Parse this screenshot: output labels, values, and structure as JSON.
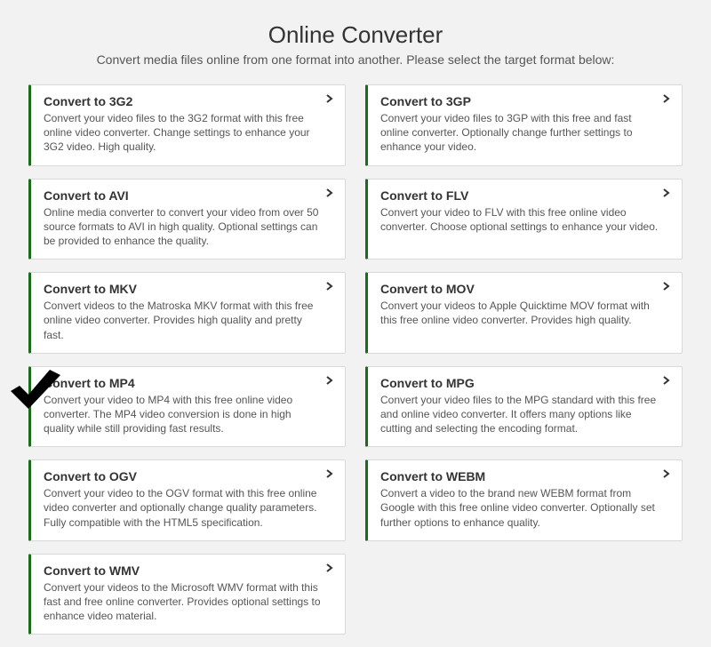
{
  "header": {
    "title": "Online Converter",
    "subtitle": "Convert media files online from one format into another. Please select the target format below:"
  },
  "colors": {
    "accent": "#1c6b1c",
    "card_bg": "#ffffff",
    "page_bg": "#f2f2f2",
    "border": "#d9d9d9",
    "text": "#333333",
    "subtext": "#555555"
  },
  "selected_index": 6,
  "cards": [
    {
      "id": "3g2",
      "title": "Convert to 3G2",
      "desc": "Convert your video files to the 3G2 format with this free online video converter. Change settings to enhance your 3G2 video. High quality."
    },
    {
      "id": "3gp",
      "title": "Convert to 3GP",
      "desc": "Convert your video files to 3GP with this free and fast online converter. Optionally change further settings to enhance your video."
    },
    {
      "id": "avi",
      "title": "Convert to AVI",
      "desc": "Online media converter to convert your video from over 50 source formats to AVI in high quality. Optional settings can be provided to enhance the quality."
    },
    {
      "id": "flv",
      "title": "Convert to FLV",
      "desc": "Convert your video to FLV with this free online video converter. Choose optional settings to enhance your video."
    },
    {
      "id": "mkv",
      "title": "Convert to MKV",
      "desc": "Convert videos to the Matroska MKV format with this free online video converter. Provides high quality and pretty fast."
    },
    {
      "id": "mov",
      "title": "Convert to MOV",
      "desc": "Convert your videos to Apple Quicktime MOV format with this free online video converter. Provides high quality."
    },
    {
      "id": "mp4",
      "title": "Convert to MP4",
      "desc": "Convert your video to MP4 with this free online video converter. The MP4 video conversion is done in high quality while still providing fast results."
    },
    {
      "id": "mpg",
      "title": "Convert to MPG",
      "desc": "Convert your video files to the MPG standard with this free and online video converter. It offers many options like cutting and selecting the encoding format."
    },
    {
      "id": "ogv",
      "title": "Convert to OGV",
      "desc": "Convert your video to the OGV format with this free online video converter and optionally change quality parameters. Fully compatible with the HTML5 specification."
    },
    {
      "id": "webm",
      "title": "Convert to WEBM",
      "desc": "Convert a video to the brand new WEBM format from Google with this free online video converter. Optionally set further options to enhance quality."
    },
    {
      "id": "wmv",
      "title": "Convert to WMV",
      "desc": "Convert your videos to the Microsoft WMV format with this fast and free online converter. Provides optional settings to enhance video material."
    }
  ]
}
